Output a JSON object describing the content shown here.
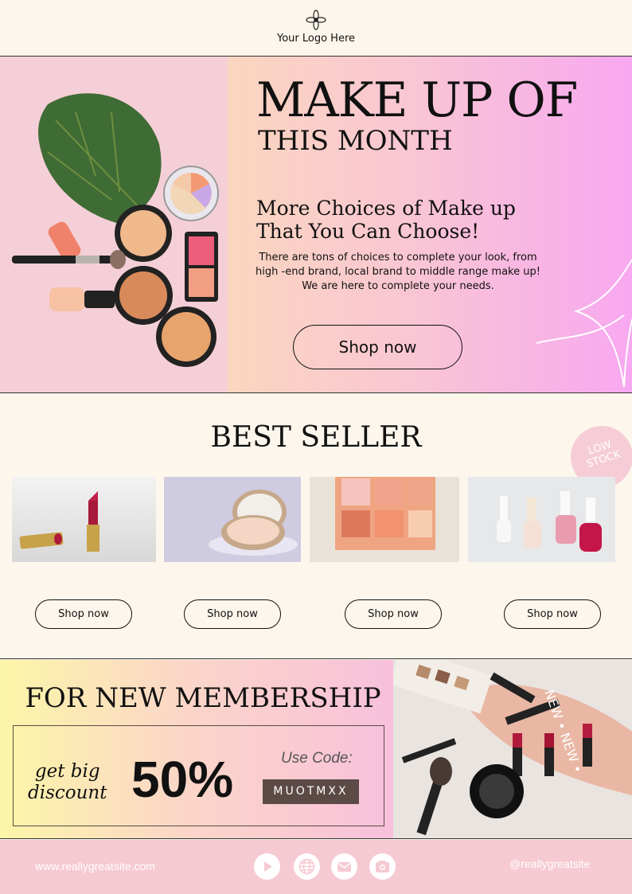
{
  "header": {
    "logo_text": "Your Logo Here"
  },
  "hero": {
    "title_line1": "MAKE UP OF",
    "title_line2": "THIS MONTH",
    "subtitle": "More Choices of Make up\nThat You Can Choose!",
    "body": "There are tons of choices to complete your look, from\nhigh -end brand, local brand to middle range make up!\nWe are here to complete your needs.",
    "button_label": "Shop now"
  },
  "best_seller": {
    "title": "BEST SELLER",
    "badge": "LOW\nSTOCK",
    "products": [
      {
        "name": "lipstick",
        "button": "Shop now"
      },
      {
        "name": "compact",
        "button": "Shop now"
      },
      {
        "name": "palette",
        "button": "Shop now"
      },
      {
        "name": "nail-polish",
        "button": "Shop now"
      }
    ]
  },
  "membership": {
    "title": "FOR NEW MEMBERSHIP",
    "tagline": "get big\ndiscount",
    "discount": "50%",
    "use_code_label": "Use Code:",
    "code": "MUOTMXX",
    "photo_text": "NEW • NEW •"
  },
  "footer": {
    "website": "www.reallygreatsite.com",
    "handle": "@reallygreatsite",
    "icons": [
      "play-icon",
      "globe-icon",
      "mail-icon",
      "camera-icon"
    ]
  },
  "colors": {
    "cream": "#fdf6ec",
    "pink": "#f6cad2",
    "magenta": "#f8a8f0",
    "code_bg": "#5b4a45"
  }
}
